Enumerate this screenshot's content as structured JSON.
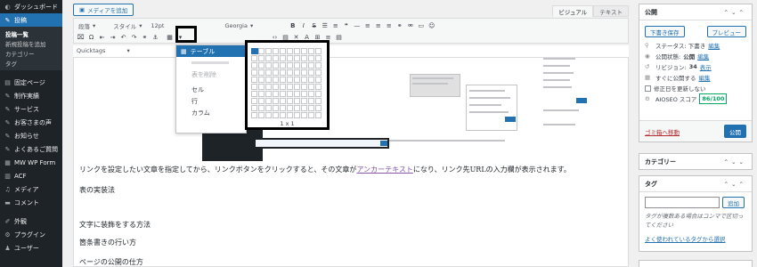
{
  "sidebar": {
    "items": [
      {
        "label": "ダッシュボード",
        "icon": "dashboard-icon",
        "glyph": "◐"
      },
      {
        "label": "投稿",
        "icon": "pin-icon",
        "glyph": "✎",
        "current": true
      }
    ],
    "submenu": [
      {
        "label": "投稿一覧",
        "current": true
      },
      {
        "label": "新規投稿を追加"
      },
      {
        "label": "カテゴリー"
      },
      {
        "label": "タグ"
      }
    ],
    "items2": [
      {
        "label": "固定ページ",
        "icon": "page-icon",
        "glyph": "▤"
      },
      {
        "label": "制作実績",
        "icon": "pin-icon",
        "glyph": "✎"
      },
      {
        "label": "サービス",
        "icon": "pin-icon",
        "glyph": "✎"
      },
      {
        "label": "お客さまの声",
        "icon": "pin-icon",
        "glyph": "✎"
      },
      {
        "label": "お知らせ",
        "icon": "pin-icon",
        "glyph": "✎"
      },
      {
        "label": "よくあるご質問",
        "icon": "pin-icon",
        "glyph": "✎"
      },
      {
        "label": "MW WP Form",
        "icon": "form-icon",
        "glyph": "▦"
      },
      {
        "label": "ACF",
        "icon": "acf-icon",
        "glyph": "▥"
      },
      {
        "label": "メディア",
        "icon": "media-icon",
        "glyph": "♫"
      },
      {
        "label": "コメント",
        "icon": "comment-icon",
        "glyph": "▬"
      }
    ],
    "items3": [
      {
        "label": "外観",
        "icon": "appearance-icon",
        "glyph": "✐"
      },
      {
        "label": "プラグイン",
        "icon": "plugin-icon",
        "glyph": "⚙"
      },
      {
        "label": "ユーザー",
        "icon": "user-icon",
        "glyph": "♟"
      }
    ]
  },
  "editor": {
    "media_button": "メディアを追加",
    "tabs": [
      "ビジュアル",
      "テキスト"
    ],
    "toolbar": {
      "format_select": "段落",
      "style_select": "スタイル",
      "size_select": "12pt",
      "font_select": "Georgia",
      "quicktags": "Quicktags"
    },
    "table_menu": {
      "items": [
        "テーブル",
        "表を削除",
        "セル",
        "行",
        "カラム"
      ],
      "grid_label": "1 x 1"
    },
    "body": [
      "リンクを設定したい文章を指定してから、リンクボタンをクリックすると、その文章が",
      "アンカーテキスト",
      "になり、リンク先URLの入力欄が表示されます。",
      "表の実装法",
      "文字に装飾をする方法",
      "箇条書きの行い方",
      "ページの公開の仕方"
    ]
  },
  "publish": {
    "title": "公開",
    "save_draft": "下書き保存",
    "preview": "プレビュー",
    "status_label": "ステータス: 下書き",
    "status_edit": "編集",
    "visibility_label": "公開状態:",
    "visibility_value": "公開",
    "visibility_edit": "編集",
    "revisions_label": "リビジョン:",
    "revisions_count": "34",
    "revisions_link": "表示",
    "schedule_label": "すぐに公開する",
    "schedule_edit": "編集",
    "no_update_date": "修正日を更新しない",
    "aioseo_label": "AIOSEO スコア",
    "aioseo_score": "86/100",
    "trash": "ゴミ箱へ移動",
    "publish_button": "公開"
  },
  "category_box": {
    "title": "カテゴリー"
  },
  "tag_box": {
    "title": "タグ",
    "add_button": "追加",
    "help": "タグが複数ある場合はコンマで区切ってください",
    "popular_link": "よく使われているタグから選択"
  },
  "colors": {
    "accent": "#2271b1",
    "sidebar": "#1d2327",
    "aioseo": "#00aa63"
  }
}
